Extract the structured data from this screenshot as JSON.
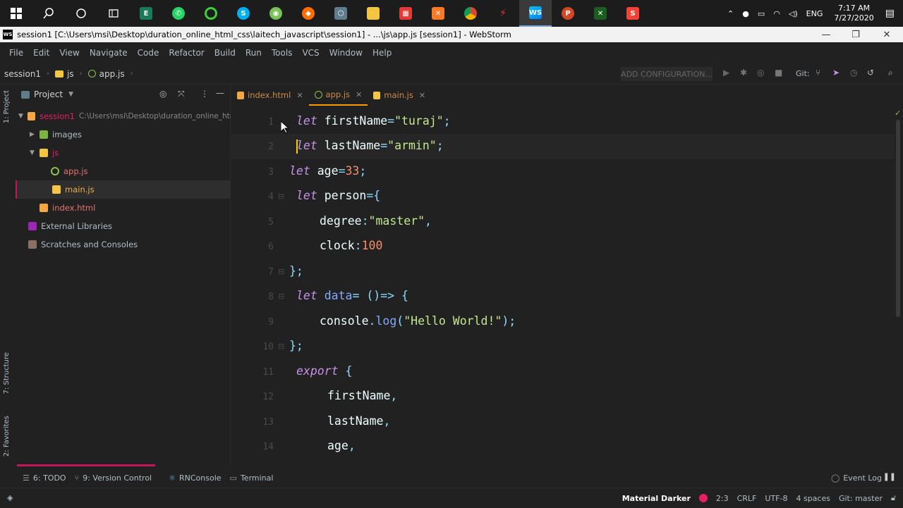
{
  "taskbar": {
    "language": "ENG",
    "time": "7:17 AM",
    "date": "7/27/2020"
  },
  "window": {
    "title": "session1 [C:\\Users\\msi\\Desktop\\duration_online_html_css\\laitech_javascript\\session1] - ...\\js\\app.js [session1] - WebStorm",
    "minimize": "—",
    "restore": "❐",
    "close": "✕"
  },
  "menu": [
    "File",
    "Edit",
    "View",
    "Navigate",
    "Code",
    "Refactor",
    "Build",
    "Run",
    "Tools",
    "VCS",
    "Window",
    "Help"
  ],
  "breadcrumb": [
    "session1",
    "js",
    "app.js"
  ],
  "toolbar": {
    "add_configuration": "ADD CONFIGURATION...",
    "git_label": "Git:"
  },
  "left_strip": {
    "project": "1: Project",
    "structure": "7: Structure",
    "favorites": "2: Favorites"
  },
  "project_panel": {
    "title": "Project",
    "root_name": "session1",
    "root_path": "C:\\Users\\msi\\Desktop\\duration_online_html_",
    "items": {
      "images": "images",
      "js": "js",
      "app": "app.js",
      "main": "main.js",
      "index": "index.html",
      "external": "External Libraries",
      "scratches": "Scratches and Consoles"
    }
  },
  "tabs": [
    {
      "label": "index.html",
      "close": "✕"
    },
    {
      "label": "app.js",
      "close": "✕"
    },
    {
      "label": "main.js",
      "close": "✕"
    }
  ],
  "editor": {
    "line_numbers": [
      "1",
      "2",
      "3",
      "4",
      "5",
      "6",
      "7",
      "8",
      "9",
      "10",
      "11",
      "12",
      "13",
      "14"
    ],
    "lines": {
      "l1": {
        "kw": "let",
        "id": "firstName",
        "eq": "=",
        "str": "\"turaj\"",
        "end": ";"
      },
      "l2": {
        "kw": "let",
        "id": "lastName",
        "eq": "=",
        "str": "\"armin\"",
        "end": ";"
      },
      "l3": {
        "kw": "let",
        "id": "age",
        "eq": "=",
        "num": "33",
        "end": ";"
      },
      "l4": {
        "kw": "let",
        "id": "person",
        "eq": "=",
        "brace": "{"
      },
      "l5": {
        "key": "degree",
        "colon": ":",
        "str": "\"master\"",
        "comma": ","
      },
      "l6": {
        "key": "clock",
        "colon": ":",
        "num": "100"
      },
      "l7": {
        "close": "};"
      },
      "l8": {
        "kw": "let",
        "id": "data",
        "eq": "=",
        "arrow": " ()=> {"
      },
      "l9": {
        "obj": "console",
        "dot": ".",
        "fn": "log",
        "open": "(",
        "str": "\"Hello World!\"",
        "close": ");"
      },
      "l10": {
        "close": "};"
      },
      "l11": {
        "kw": "export",
        "brace": " {"
      },
      "l12": {
        "id": "firstName",
        "comma": ","
      },
      "l13": {
        "id": "lastName",
        "comma": ","
      },
      "l14": {
        "id": "age",
        "comma": ","
      }
    }
  },
  "bottom_tabs": [
    "6: TODO",
    "9: Version Control",
    "RNConsole",
    "Terminal"
  ],
  "event_log": "Event Log",
  "status": {
    "theme": "Material Darker",
    "position": "2:3",
    "line_sep": "CRLF",
    "encoding": "UTF-8",
    "indent": "4 spaces",
    "git": "Git: master"
  },
  "colors": {
    "keyword": "#c792ea",
    "string": "#c3e88d",
    "number": "#f78c6c",
    "accent": "#ff9800"
  }
}
